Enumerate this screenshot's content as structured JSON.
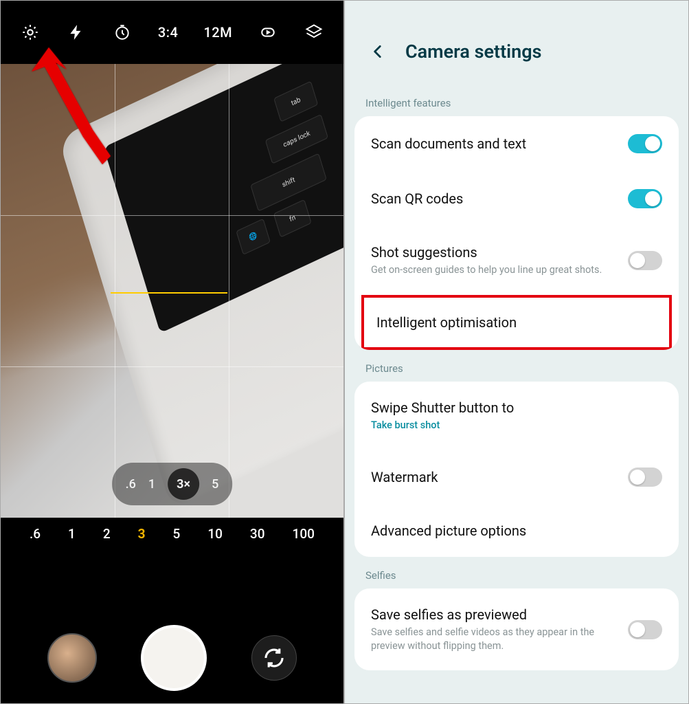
{
  "camera": {
    "top": {
      "ratio": "3:4",
      "megapixels": "12M"
    },
    "zoom_pill": [
      ".6",
      "1",
      "3×",
      "5"
    ],
    "zoom_pill_selected": "3×",
    "zoom_row": [
      ".6",
      "1",
      "2",
      "3",
      "5",
      "10",
      "30",
      "100"
    ],
    "zoom_row_selected": "3"
  },
  "settings": {
    "title": "Camera settings",
    "sections": {
      "intelligent": {
        "label": "Intelligent features",
        "items": {
          "scan_docs": {
            "title": "Scan documents and text",
            "on": true
          },
          "scan_qr": {
            "title": "Scan QR codes",
            "on": true
          },
          "shot_sugg": {
            "title": "Shot suggestions",
            "sub": "Get on-screen guides to help you line up great shots.",
            "on": false
          },
          "intel_opt": {
            "title": "Intelligent optimisation"
          }
        }
      },
      "pictures": {
        "label": "Pictures",
        "items": {
          "swipe": {
            "title": "Swipe Shutter button to",
            "sub": "Take burst shot"
          },
          "watermark": {
            "title": "Watermark",
            "on": false
          },
          "advanced": {
            "title": "Advanced picture options"
          }
        }
      },
      "selfies": {
        "label": "Selfies",
        "items": {
          "save_prev": {
            "title": "Save selfies as previewed",
            "sub": "Save selfies and selfie videos as they appear in the preview without flipping them.",
            "on": false
          }
        }
      }
    }
  },
  "viewfinder_keys": {
    "tab": "tab",
    "caps": "caps lock",
    "shift": "shift",
    "fn": "fn"
  }
}
